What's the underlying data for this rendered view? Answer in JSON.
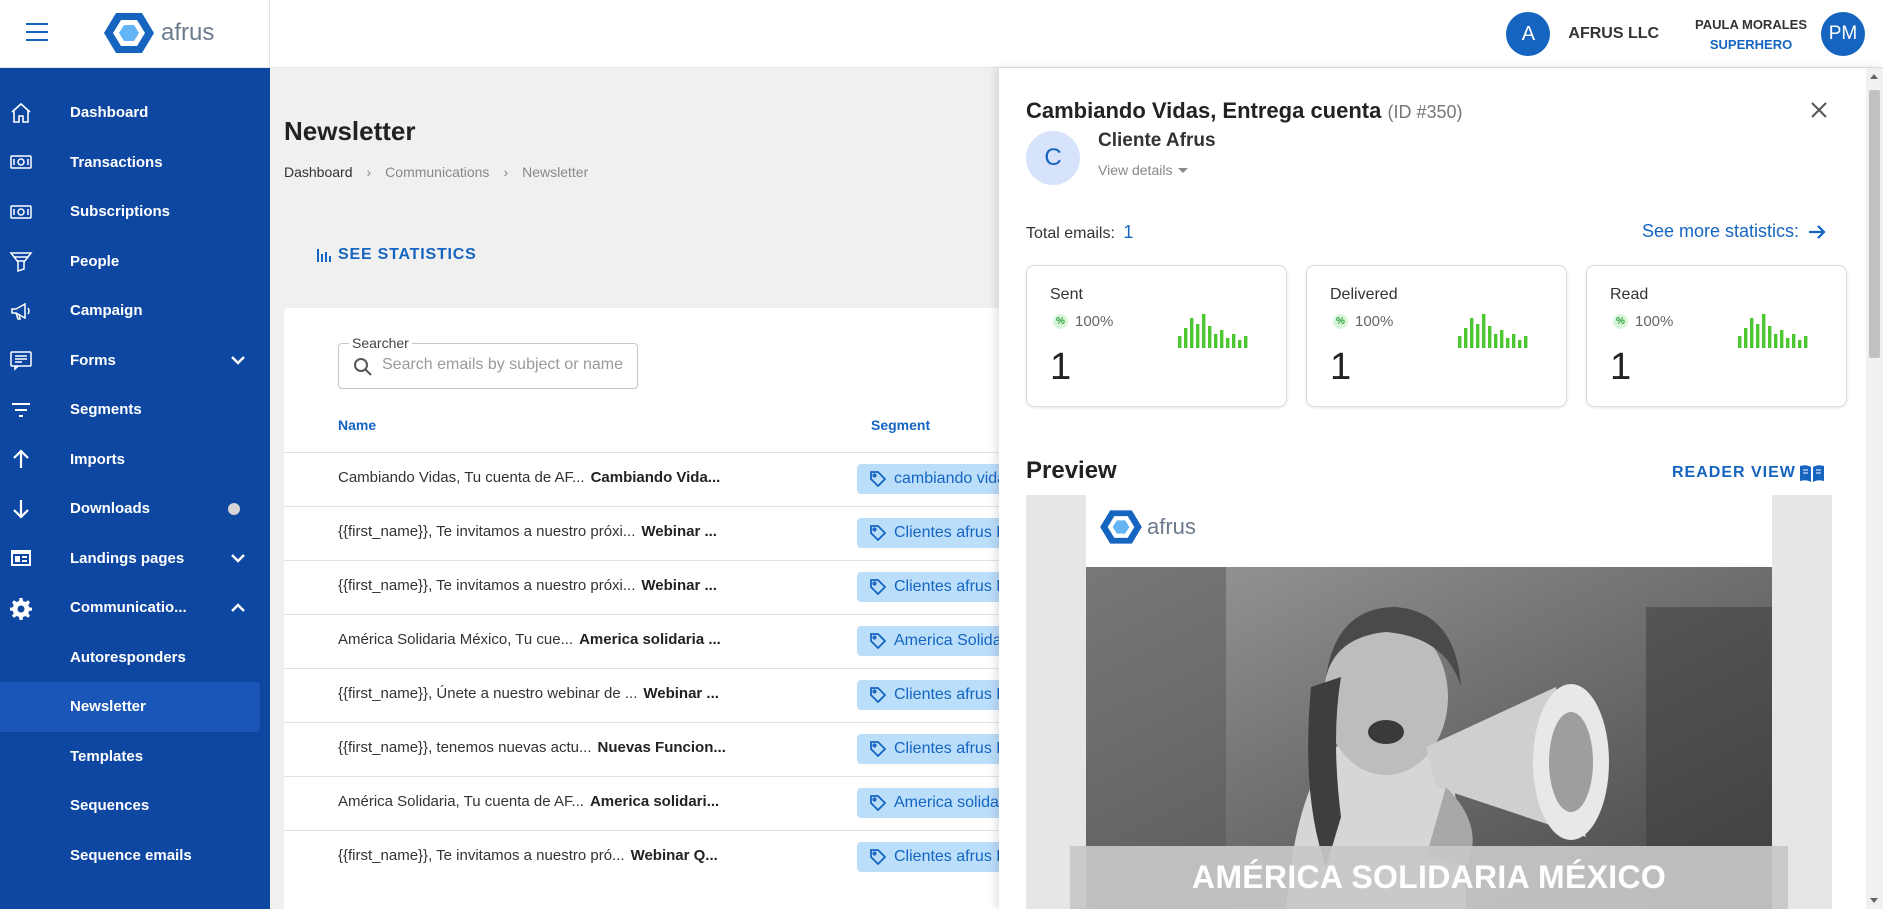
{
  "brand": {
    "name": "afrus"
  },
  "header": {
    "org_initial": "A",
    "org_name": "AFRUS LLC",
    "user_name": "PAULA MORALES",
    "user_role": "SUPERHERO",
    "user_initials": "PM"
  },
  "sidebar": {
    "items": [
      {
        "label": "Dashboard",
        "icon": "home-icon"
      },
      {
        "label": "Transactions",
        "icon": "money-icon"
      },
      {
        "label": "Subscriptions",
        "icon": "money-icon"
      },
      {
        "label": "People",
        "icon": "funnel-icon"
      },
      {
        "label": "Campaign",
        "icon": "megaphone-icon"
      },
      {
        "label": "Forms",
        "icon": "form-icon"
      },
      {
        "label": "Segments",
        "icon": "filter-lines-icon"
      },
      {
        "label": "Imports",
        "icon": "arrow-up-icon"
      },
      {
        "label": "Downloads",
        "icon": "arrow-down-icon"
      },
      {
        "label": "Landings pages",
        "icon": "web-icon"
      },
      {
        "label": "Communicatio...",
        "icon": "gear-icon"
      }
    ],
    "sub_items": [
      {
        "label": "Autoresponders"
      },
      {
        "label": "Newsletter"
      },
      {
        "label": "Templates"
      },
      {
        "label": "Sequences"
      },
      {
        "label": "Sequence emails"
      }
    ]
  },
  "main": {
    "title": "Newsletter",
    "breadcrumb": [
      "Dashboard",
      "Communications",
      "Newsletter"
    ],
    "see_statistics": "SEE STATISTICS",
    "searcher_label": "Searcher",
    "searcher_placeholder": "Search emails by subject or name",
    "columns": {
      "name": "Name",
      "segment": "Segment"
    },
    "rows": [
      {
        "subject": "Cambiando Vidas, Tu cuenta de AF...",
        "name": "Cambiando Vida...",
        "segment": "cambiando vida"
      },
      {
        "subject": "{{first_name}}, Te invitamos a nuestro próxi...",
        "name": "Webinar ...",
        "segment": "Clientes afrus L"
      },
      {
        "subject": "{{first_name}}, Te invitamos a nuestro próxi...",
        "name": "Webinar ...",
        "segment": "Clientes afrus L"
      },
      {
        "subject": "América Solidaria México, Tu cue...",
        "name": "America solidaria ...",
        "segment": "America Solida"
      },
      {
        "subject": "{{first_name}}, Únete a nuestro webinar de ...",
        "name": "Webinar ...",
        "segment": "Clientes afrus L"
      },
      {
        "subject": "{{first_name}}, tenemos nuevas actu...",
        "name": "Nuevas Funcion...",
        "segment": "Clientes afrus L"
      },
      {
        "subject": "América Solidaria, Tu cuenta de AF...",
        "name": "America solidari...",
        "segment": "America solida"
      },
      {
        "subject": "{{first_name}}, Te invitamos a nuestro pró...",
        "name": "Webinar Q...",
        "segment": "Clientes afrus L"
      }
    ]
  },
  "panel": {
    "title": "Cambiando Vidas, Entrega cuenta",
    "id_text": "(ID #350)",
    "client_initial": "C",
    "client_name": "Cliente Afrus",
    "view_details": "View details",
    "total_emails_label": "Total emails:",
    "total_emails_value": "1",
    "see_more_statistics": "See more statistics:",
    "stats": [
      {
        "label": "Sent",
        "percent": "100%",
        "value": "1"
      },
      {
        "label": "Delivered",
        "percent": "100%",
        "value": "1"
      },
      {
        "label": "Read",
        "percent": "100%",
        "value": "1"
      }
    ],
    "preview_title": "Preview",
    "reader_view": "READER VIEW",
    "email_brand": "afrus",
    "email_banner": "AMÉRICA SOLIDARIA MÉXICO"
  },
  "colors": {
    "primary": "#1565c0",
    "sidebar_bg": "#0d47a1",
    "tag_bg": "#bbdefb",
    "spark_green": "#4cc72f"
  }
}
